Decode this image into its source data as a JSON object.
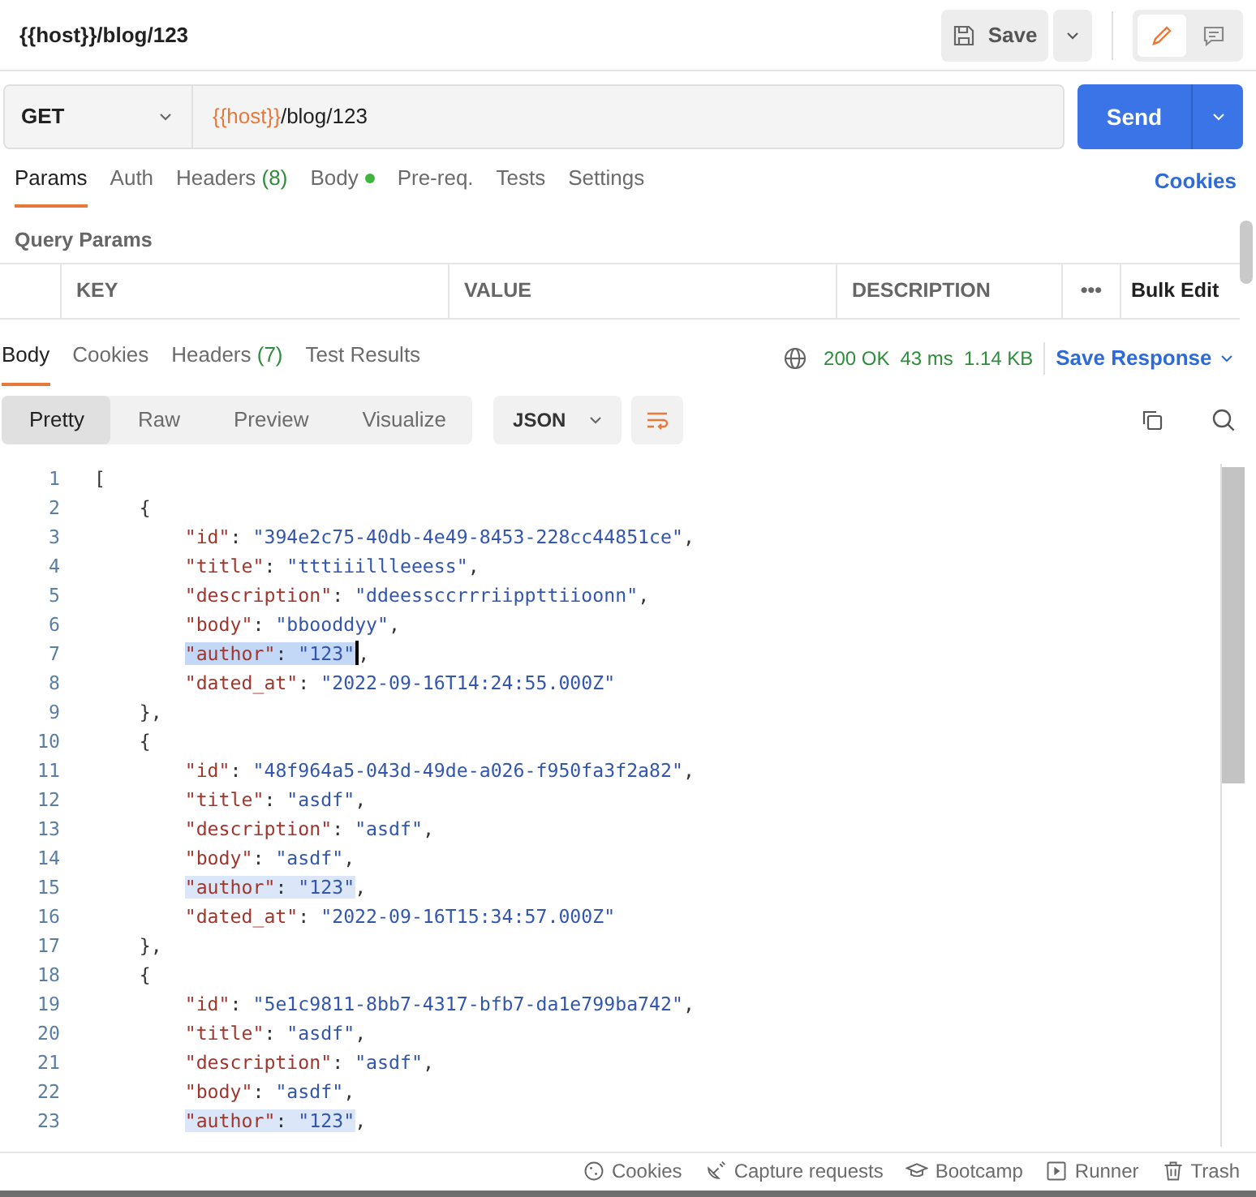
{
  "request": {
    "title": "{{host}}/blog/123",
    "save_label": "Save",
    "method": "GET",
    "url_variable": "{{host}}",
    "url_path": "/blog/123",
    "send_label": "Send"
  },
  "mode_toggle": [
    {
      "kind": "edit",
      "selected": true
    },
    {
      "kind": "comment",
      "selected": false
    }
  ],
  "request_tabs": [
    {
      "label": "Params",
      "dot": false,
      "selected": true
    },
    {
      "label": "Auth",
      "dot": false,
      "selected": false
    },
    {
      "label": "Headers",
      "count": "(8)",
      "dot": false,
      "selected": false
    },
    {
      "label": "Body",
      "dot": true,
      "selected": false
    },
    {
      "label": "Pre-req.",
      "dot": false,
      "selected": false
    },
    {
      "label": "Tests",
      "dot": false,
      "selected": false
    },
    {
      "label": "Settings",
      "dot": false,
      "selected": false
    }
  ],
  "cookies_link": "Cookies",
  "query_params": {
    "title": "Query Params",
    "columns": [
      "KEY",
      "VALUE",
      "DESCRIPTION"
    ],
    "more": "•••",
    "bulk_edit": "Bulk Edit"
  },
  "response_tabs": [
    {
      "label": "Body",
      "selected": true
    },
    {
      "label": "Cookies",
      "selected": false
    },
    {
      "label": "Headers",
      "count": "(7)",
      "selected": false
    },
    {
      "label": "Test Results",
      "selected": false
    }
  ],
  "response_meta": {
    "status": "200 OK",
    "time": "43 ms",
    "size": "1.14 KB",
    "save_response": "Save Response"
  },
  "view_modes": [
    {
      "label": "Pretty",
      "selected": true
    },
    {
      "label": "Raw",
      "selected": false
    },
    {
      "label": "Preview",
      "selected": false
    },
    {
      "label": "Visualize",
      "selected": false
    }
  ],
  "format": "JSON",
  "code_lines": [
    {
      "number": "1",
      "tokens": [
        {
          "kind": "punct",
          "text": "["
        }
      ]
    },
    {
      "number": "2",
      "tokens": [
        {
          "kind": "punct",
          "text": "    {"
        }
      ]
    },
    {
      "number": "3",
      "tokens": [
        {
          "kind": "key",
          "text": "        \"id\""
        },
        {
          "kind": "punct",
          "text": ": "
        },
        {
          "kind": "string",
          "text": "\"394e2c75-40db-4e49-8453-228cc44851ce\""
        },
        {
          "kind": "punct",
          "text": ","
        }
      ]
    },
    {
      "number": "4",
      "tokens": [
        {
          "kind": "key",
          "text": "        \"title\""
        },
        {
          "kind": "punct",
          "text": ": "
        },
        {
          "kind": "string",
          "text": "\"tttiiillleeess\""
        },
        {
          "kind": "punct",
          "text": ","
        }
      ]
    },
    {
      "number": "5",
      "tokens": [
        {
          "kind": "key",
          "text": "        \"description\""
        },
        {
          "kind": "punct",
          "text": ": "
        },
        {
          "kind": "string",
          "text": "\"ddeessccrrriippttiioonn\""
        },
        {
          "kind": "punct",
          "text": ","
        }
      ]
    },
    {
      "number": "6",
      "tokens": [
        {
          "kind": "key",
          "text": "        \"body\""
        },
        {
          "kind": "punct",
          "text": ": "
        },
        {
          "kind": "string",
          "text": "\"bbooddyy\""
        },
        {
          "kind": "punct",
          "text": ","
        }
      ]
    },
    {
      "number": "7",
      "highlighted": true,
      "cursor": true,
      "tokens": [
        {
          "kind": "key",
          "text": "        \"author\""
        },
        {
          "kind": "punct",
          "text": ": "
        },
        {
          "kind": "string",
          "text": "\"123\""
        },
        {
          "kind": "punct",
          "text": ","
        }
      ]
    },
    {
      "number": "8",
      "tokens": [
        {
          "kind": "key",
          "text": "        \"dated_at\""
        },
        {
          "kind": "punct",
          "text": ": "
        },
        {
          "kind": "string",
          "text": "\"2022-09-16T14:24:55.000Z\""
        }
      ]
    },
    {
      "number": "9",
      "tokens": [
        {
          "kind": "punct",
          "text": "    },"
        }
      ]
    },
    {
      "number": "10",
      "tokens": [
        {
          "kind": "punct",
          "text": "    {"
        }
      ]
    },
    {
      "number": "11",
      "tokens": [
        {
          "kind": "key",
          "text": "        \"id\""
        },
        {
          "kind": "punct",
          "text": ": "
        },
        {
          "kind": "string",
          "text": "\"48f964a5-043d-49de-a026-f950fa3f2a82\""
        },
        {
          "kind": "punct",
          "text": ","
        }
      ]
    },
    {
      "number": "12",
      "tokens": [
        {
          "kind": "key",
          "text": "        \"title\""
        },
        {
          "kind": "punct",
          "text": ": "
        },
        {
          "kind": "string",
          "text": "\"asdf\""
        },
        {
          "kind": "punct",
          "text": ","
        }
      ]
    },
    {
      "number": "13",
      "tokens": [
        {
          "kind": "key",
          "text": "        \"description\""
        },
        {
          "kind": "punct",
          "text": ": "
        },
        {
          "kind": "string",
          "text": "\"asdf\""
        },
        {
          "kind": "punct",
          "text": ","
        }
      ]
    },
    {
      "number": "14",
      "tokens": [
        {
          "kind": "key",
          "text": "        \"body\""
        },
        {
          "kind": "punct",
          "text": ": "
        },
        {
          "kind": "string",
          "text": "\"asdf\""
        },
        {
          "kind": "punct",
          "text": ","
        }
      ]
    },
    {
      "number": "15",
      "highlighted": true,
      "tokens": [
        {
          "kind": "key",
          "text": "        \"author\""
        },
        {
          "kind": "punct",
          "text": ": "
        },
        {
          "kind": "string",
          "text": "\"123\""
        },
        {
          "kind": "punct",
          "text": ","
        }
      ]
    },
    {
      "number": "16",
      "tokens": [
        {
          "kind": "key",
          "text": "        \"dated_at\""
        },
        {
          "kind": "punct",
          "text": ": "
        },
        {
          "kind": "string",
          "text": "\"2022-09-16T15:34:57.000Z\""
        }
      ]
    },
    {
      "number": "17",
      "tokens": [
        {
          "kind": "punct",
          "text": "    },"
        }
      ]
    },
    {
      "number": "18",
      "tokens": [
        {
          "kind": "punct",
          "text": "    {"
        }
      ]
    },
    {
      "number": "19",
      "tokens": [
        {
          "kind": "key",
          "text": "        \"id\""
        },
        {
          "kind": "punct",
          "text": ": "
        },
        {
          "kind": "string",
          "text": "\"5e1c9811-8bb7-4317-bfb7-da1e799ba742\""
        },
        {
          "kind": "punct",
          "text": ","
        }
      ]
    },
    {
      "number": "20",
      "tokens": [
        {
          "kind": "key",
          "text": "        \"title\""
        },
        {
          "kind": "punct",
          "text": ": "
        },
        {
          "kind": "string",
          "text": "\"asdf\""
        },
        {
          "kind": "punct",
          "text": ","
        }
      ]
    },
    {
      "number": "21",
      "tokens": [
        {
          "kind": "key",
          "text": "        \"description\""
        },
        {
          "kind": "punct",
          "text": ": "
        },
        {
          "kind": "string",
          "text": "\"asdf\""
        },
        {
          "kind": "punct",
          "text": ","
        }
      ]
    },
    {
      "number": "22",
      "tokens": [
        {
          "kind": "key",
          "text": "        \"body\""
        },
        {
          "kind": "punct",
          "text": ": "
        },
        {
          "kind": "string",
          "text": "\"asdf\""
        },
        {
          "kind": "punct",
          "text": ","
        }
      ]
    },
    {
      "number": "23",
      "highlighted": true,
      "tokens": [
        {
          "kind": "key",
          "text": "        \"author\""
        },
        {
          "kind": "punct",
          "text": ": "
        },
        {
          "kind": "string",
          "text": "\"123\""
        },
        {
          "kind": "punct",
          "text": ","
        }
      ]
    }
  ],
  "status_bar": [
    {
      "kind": "cookie",
      "label": "Cookies"
    },
    {
      "kind": "capture",
      "label": "Capture requests"
    },
    {
      "kind": "cap",
      "label": "Bootcamp"
    },
    {
      "kind": "play",
      "label": "Runner"
    },
    {
      "kind": "trash",
      "label": "Trash"
    }
  ]
}
